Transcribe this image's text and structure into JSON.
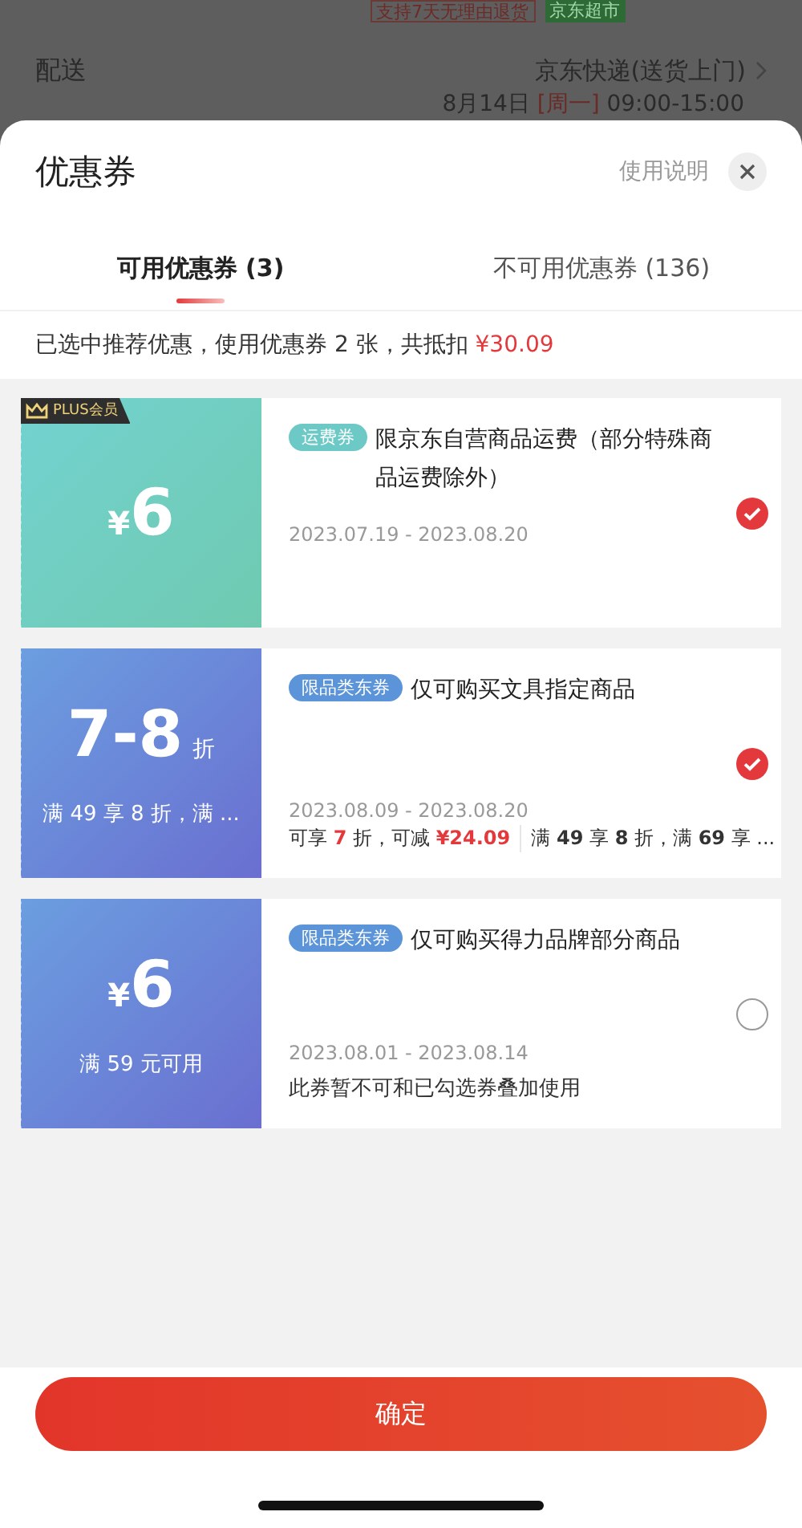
{
  "background_page": {
    "badges": [
      {
        "label": "支持7天无理由退货",
        "kind": "outline"
      },
      {
        "label": "京东超市",
        "kind": "filled"
      }
    ],
    "delivery": {
      "label": "配送",
      "method": "京东快递(送货上门)",
      "time_prefix": "8月14日",
      "weekday": "[周一]",
      "time_range": "09:00-15:00"
    }
  },
  "sheet": {
    "title": "优惠券",
    "help_link": "使用说明",
    "tabs": [
      {
        "label": "可用优惠券 (3)",
        "selected": true
      },
      {
        "label": "不可用优惠券 (136)",
        "selected": false
      }
    ],
    "summary": {
      "text": "已选中推荐优惠，使用优惠券 2 张，共抵扣 ",
      "amount": "¥30.09"
    },
    "coupons": [
      {
        "kind": "shipping",
        "plus_badge": "PLUS会员",
        "symbol": "¥",
        "value": "6",
        "tag": "运费券",
        "title": "限京东自营商品运费（部分特殊商品运费除外）",
        "dates": "2023.07.19 - 2023.08.20",
        "selected": true
      },
      {
        "kind": "category",
        "value": "7-8",
        "unit": "折",
        "condition": "满 49 享 8 折，满 ...",
        "tag": "限品类东券",
        "title": "仅可购买文具指定商品",
        "dates": "2023.08.09 - 2023.08.20",
        "savings": [
          {
            "text": "可享 ",
            "highlight": false
          },
          {
            "text": "7",
            "highlight": true
          },
          {
            "text": " 折，可减 ",
            "highlight": false
          },
          {
            "text": "¥24.09",
            "highlight": true
          }
        ],
        "tiers": "满 **49** 享 **8** 折，满 **69** 享 ...",
        "selected": true
      },
      {
        "kind": "category",
        "symbol": "¥",
        "value": "6",
        "condition": "满 59 元可用",
        "tag": "限品类东券",
        "title": "仅可购买得力品牌部分商品",
        "dates": "2023.08.01 - 2023.08.14",
        "note": "此券暂不可和已勾选券叠加使用",
        "selected": false
      }
    ],
    "confirm_button": "确定"
  }
}
